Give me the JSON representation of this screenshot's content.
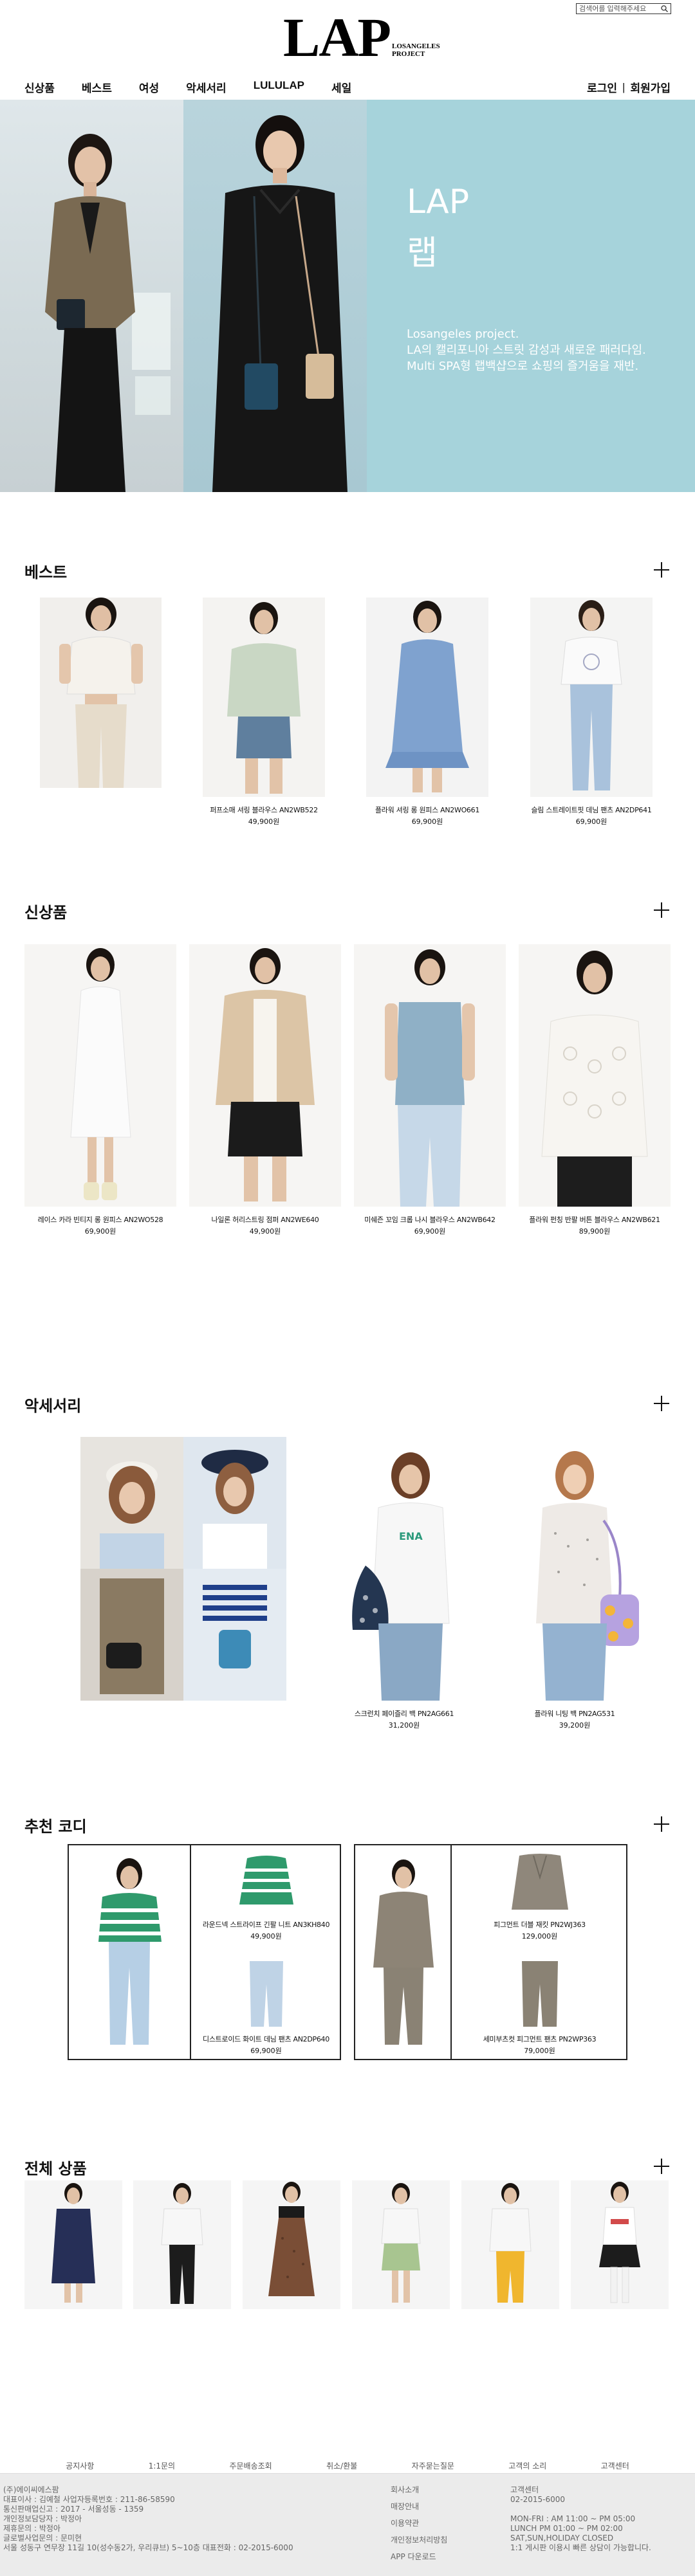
{
  "header": {
    "search_placeholder": "검색어를 입력해주세요",
    "logo_main": "LAP",
    "logo_sub_line1": "LOSANGELES",
    "logo_sub_line2": "PROJECT",
    "nav": [
      "신상품",
      "베스트",
      "여성",
      "악세서리",
      "LULULAP",
      "세일"
    ],
    "login": "로그인",
    "separator": "|",
    "join": "회원가입"
  },
  "hero": {
    "title_en": "LAP",
    "title_kr": "랩",
    "desc": [
      "Losangeles project.",
      "LA의 캘리포니아 스트릿 감성과 새로운 패러다임.",
      "Multi SPA형 랩백샵으로 쇼핑의 즐거움을 재반."
    ]
  },
  "sections": {
    "best": {
      "title": "베스트",
      "products": [
        {
          "name": "",
          "price": ""
        },
        {
          "name": "퍼프소매 셔링 블라우스 AN2WB522",
          "price": "49,900원"
        },
        {
          "name": "플라워 셔링 롱 원피스 AN2WO661",
          "price": "69,900원"
        },
        {
          "name": "슬림 스트레이트핏 데님 팬츠 AN2DP641",
          "price": "69,900원"
        }
      ]
    },
    "new": {
      "title": "신상품",
      "products": [
        {
          "name": "레이스 카라 빈티지 롱 원피스 AN2WO528",
          "price": "69,900원"
        },
        {
          "name": "나일론 허리스트링 점퍼 AN2WE640",
          "price": "49,900원"
        },
        {
          "name": "미쉐즌 꼬임 크롭 나시 블라우스 AN2WB642",
          "price": "69,900원"
        },
        {
          "name": "플라워 펀칭 반팔 버튼 블라우스 AN2WB621",
          "price": "89,900원"
        }
      ]
    },
    "accessory": {
      "title": "악세서리",
      "products": [
        {
          "name": "",
          "price": ""
        },
        {
          "name": "스크런치 페이즐리 백 PN2AG661",
          "price": "31,200원"
        },
        {
          "name": "플라워 니팅 백 PN2AG531",
          "price": "39,200원"
        }
      ]
    },
    "coordi": {
      "title": "추천 코디",
      "sets": [
        {
          "items": [
            {
              "name": "라운드넥 스트라이프 긴팔 니트 AN3KH840",
              "price": "49,900원"
            },
            {
              "name": "디스트로이드 화이트 데님 팬츠 AN2DP640",
              "price": "69,900원"
            }
          ]
        },
        {
          "items": [
            {
              "name": "피그먼트 더블 재킷 PN2WJ363",
              "price": "129,000원"
            },
            {
              "name": "세미부츠컷 피그먼트 팬츠 PN2WP363",
              "price": "79,000원"
            }
          ]
        }
      ]
    },
    "all": {
      "title": "전체 상품"
    }
  },
  "footer": {
    "links": [
      "공지사항",
      "1:1문의",
      "주문배송조회",
      "취소/환불",
      "자주묻는질문",
      "고객의 소리",
      "고객센터"
    ],
    "company": [
      "(주)에이씨에스팜",
      "대표이사 : 김예철 사업자등록번호 : 211-86-58590",
      "통신판매업신고 : 2017 - 서울성동 - 1359",
      "개인정보담당자 : 박정아",
      "제휴문의 : 박정아",
      "글로벌사업문의 : 문미현",
      "서울 성동구 연무장 11길 10(성수동2가, 우리큐브) 5~10층 대표전화 : 02-2015-6000"
    ],
    "menu": [
      "회사소개",
      "매장안내",
      "이용약관",
      "개인정보처리방침",
      "APP 다운로드"
    ],
    "cs": [
      "고객센터",
      "02-2015-6000",
      "",
      "MON-FRI : AM 11:00 ~ PM 05:00",
      "LUNCH PM 01:00 ~ PM 02:00",
      "SAT,SUN,HOLIDAY CLOSED",
      "1:1 게시판 이용시 빠른 상담이 가능합니다."
    ]
  },
  "colors": {
    "hero_panel": "#a6d3db",
    "footer_bg": "#ebebeb"
  }
}
